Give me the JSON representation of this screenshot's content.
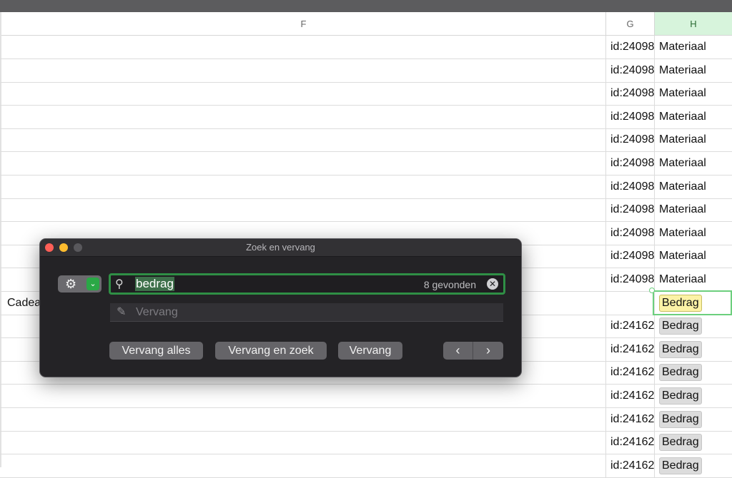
{
  "columns": {
    "f": "F",
    "g": "G",
    "h": "H"
  },
  "rows": [
    {
      "f": "",
      "g": "id:24098",
      "h": "Materiaal",
      "h_style": "plain"
    },
    {
      "f": "",
      "g": "id:24098",
      "h": "Materiaal",
      "h_style": "plain"
    },
    {
      "f": "",
      "g": "id:24098",
      "h": "Materiaal",
      "h_style": "plain"
    },
    {
      "f": "",
      "g": "id:24098",
      "h": "Materiaal",
      "h_style": "plain"
    },
    {
      "f": "",
      "g": "id:24098",
      "h": "Materiaal",
      "h_style": "plain"
    },
    {
      "f": "",
      "g": "id:24098",
      "h": "Materiaal",
      "h_style": "plain"
    },
    {
      "f": "",
      "g": "id:24098",
      "h": "Materiaal",
      "h_style": "plain"
    },
    {
      "f": "",
      "g": "id:24098",
      "h": "Materiaal",
      "h_style": "plain"
    },
    {
      "f": "",
      "g": "id:24098",
      "h": "Materiaal",
      "h_style": "plain"
    },
    {
      "f": "",
      "g": "id:24098",
      "h": "Materiaal",
      "h_style": "plain"
    },
    {
      "f": "",
      "g": "id:24098",
      "h": "Materiaal",
      "h_style": "plain"
    },
    {
      "f": "Cadea",
      "g": "",
      "h": "Bedrag",
      "h_style": "current"
    },
    {
      "f": "",
      "g": "id:24162",
      "h": "Bedrag",
      "h_style": "match"
    },
    {
      "f": "",
      "g": "id:24162",
      "h": "Bedrag",
      "h_style": "match"
    },
    {
      "f": "",
      "g": "id:24162",
      "h": "Bedrag",
      "h_style": "match"
    },
    {
      "f": "",
      "g": "id:24162",
      "h": "Bedrag",
      "h_style": "match"
    },
    {
      "f": "",
      "g": "id:24162",
      "h": "Bedrag",
      "h_style": "match"
    },
    {
      "f": "",
      "g": "id:24162",
      "h": "Bedrag",
      "h_style": "match"
    },
    {
      "f": "",
      "g": "id:24162",
      "h": "Bedrag",
      "h_style": "match"
    }
  ],
  "dialog": {
    "title": "Zoek en vervang",
    "search": {
      "value": "bedrag",
      "found_count": "8 gevonden"
    },
    "replace": {
      "placeholder": "Vervang",
      "value": ""
    },
    "buttons": {
      "replace_all": "Vervang alles",
      "replace_and_find": "Vervang en zoek",
      "replace": "Vervang"
    },
    "icons": {
      "gear": "⚙",
      "chevron": "⌄",
      "search": "⚲",
      "pencil": "✎",
      "clear": "✕",
      "prev": "‹",
      "next": "›"
    }
  },
  "colors": {
    "accent_green": "#2f8f45",
    "match_highlight": "#dcdcdc",
    "current_match": "#fcf2a6",
    "dialog_bg": "#242326"
  }
}
